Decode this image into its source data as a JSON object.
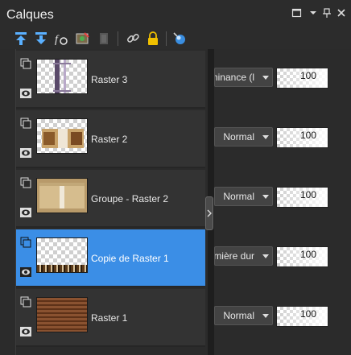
{
  "window": {
    "title": "Calques"
  },
  "toolbar": {
    "icons": [
      "new-raster-layer-icon",
      "new-vector-layer-icon",
      "new-adjustment-layer-icon",
      "mask-icon",
      "delete-layer-icon",
      "link-icon",
      "lock-icon",
      "properties-icon"
    ]
  },
  "layers": [
    {
      "name": "Raster 3",
      "blend": "minance (l",
      "opacity": "100",
      "selected": false,
      "thumb": "vertical-bars"
    },
    {
      "name": "Raster 2",
      "blend": "Normal",
      "opacity": "100",
      "selected": false,
      "thumb": "framed-scene"
    },
    {
      "name": "Groupe - Raster 2",
      "blend": "Normal",
      "opacity": "100",
      "selected": false,
      "thumb": "tan-frame"
    },
    {
      "name": "Copie de Raster 1",
      "blend": "umière dur",
      "opacity": "100",
      "selected": true,
      "thumb": "bottom-strip"
    },
    {
      "name": "Raster 1",
      "blend": "Normal",
      "opacity": "100",
      "selected": false,
      "thumb": "wood-stripes"
    }
  ],
  "colors": {
    "selected": "#3b8ee6",
    "panel": "#2b2b2b",
    "row": "#333333"
  }
}
